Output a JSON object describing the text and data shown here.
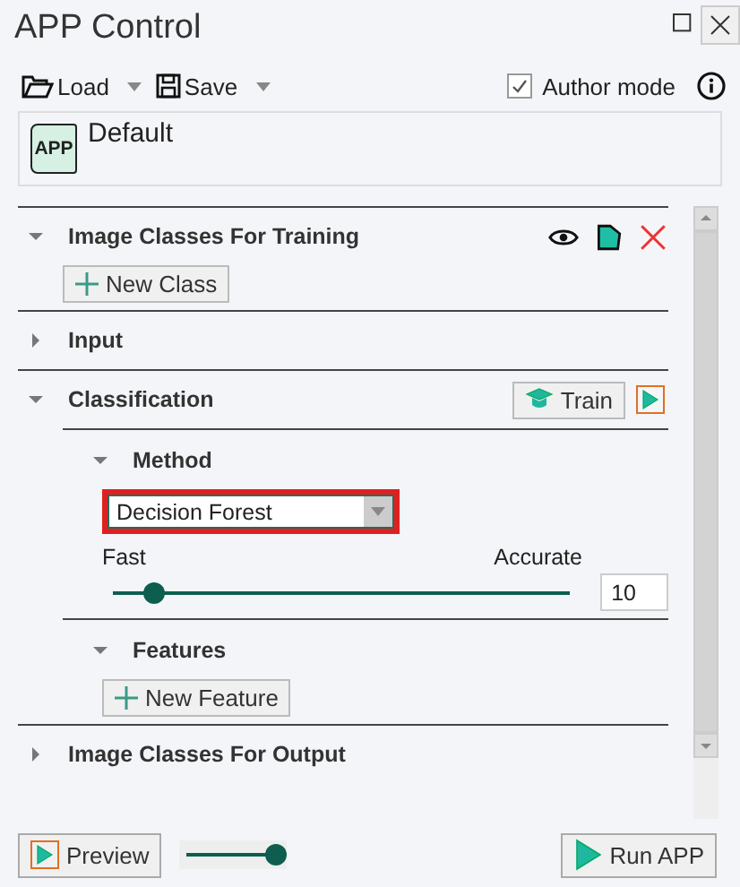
{
  "window": {
    "title": "APP Control"
  },
  "toolbar": {
    "load": "Load",
    "save": "Save",
    "author_mode": {
      "label": "Author mode",
      "checked": true
    }
  },
  "app": {
    "icon_text": "APP",
    "name": "Default"
  },
  "sections": [
    {
      "kind": "classes",
      "title": "Image Classes For Training",
      "expanded": true,
      "button": "New Class"
    },
    {
      "kind": "plain",
      "title": "Input",
      "expanded": false
    },
    {
      "kind": "classification",
      "title": "Classification",
      "expanded": true,
      "train": "Train",
      "method": {
        "title": "Method",
        "expanded": true,
        "value": "Decision Forest",
        "min_label": "Fast",
        "max_label": "Accurate",
        "level": 0.09,
        "reading": "10"
      },
      "features": {
        "title": "Features",
        "expanded": true,
        "button": "New Feature"
      }
    },
    {
      "kind": "plain",
      "title": "Image Classes For Output",
      "expanded": false
    }
  ],
  "footer": {
    "preview": "Preview",
    "preview_slider": {
      "level": 1.0
    },
    "run": "Run APP"
  }
}
